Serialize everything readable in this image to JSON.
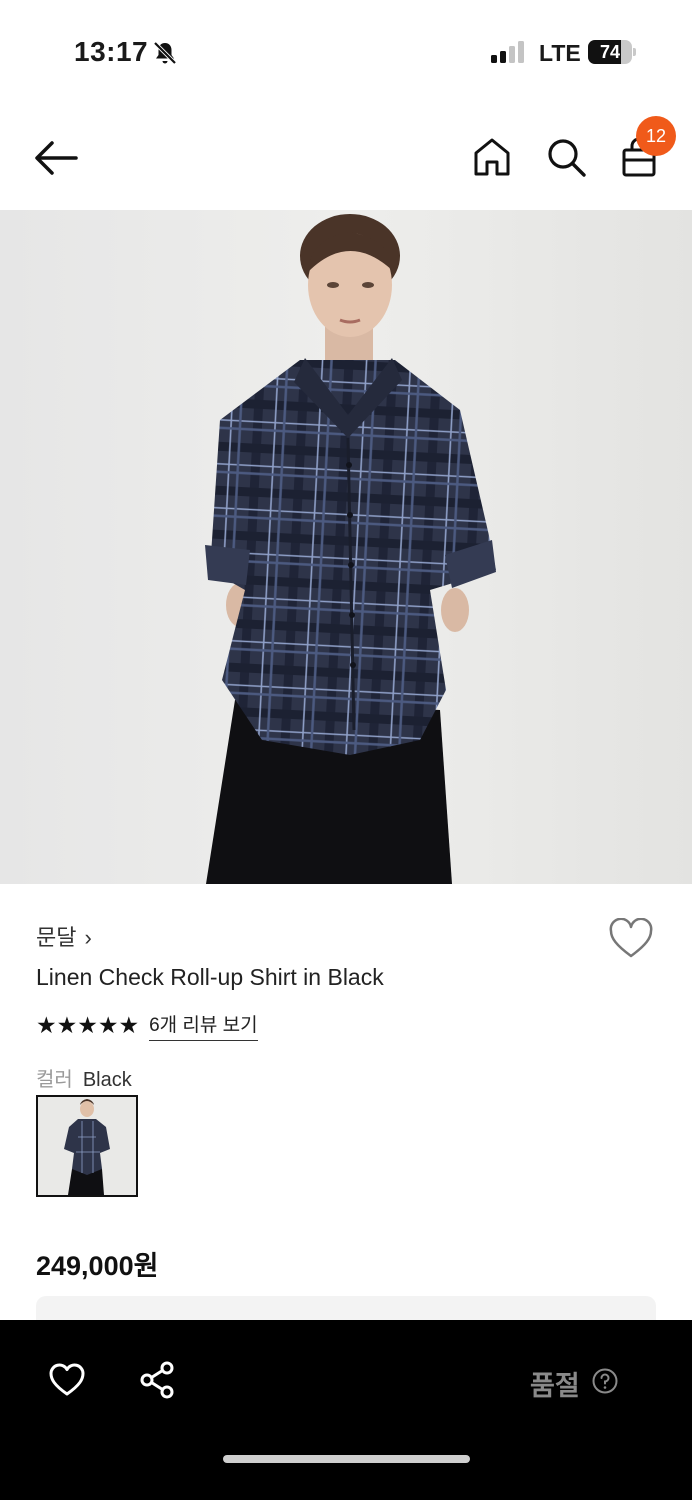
{
  "status_bar": {
    "time": "13:17",
    "network": "LTE",
    "battery_level": "74",
    "battery_fraction": 0.74
  },
  "nav": {
    "cart_count": "12",
    "icons": [
      "back-arrow-icon",
      "home-icon",
      "search-icon",
      "shopping-bag-icon"
    ]
  },
  "product": {
    "brand": "문달",
    "brand_chevron": "›",
    "title": "Linen Check Roll-up Shirt in Black",
    "stars": "★★★★★",
    "rating": 5,
    "review_link": "6개 리뷰 보기",
    "color_label": "컬러",
    "color_value": "Black",
    "price": "249,000원"
  },
  "bottom_bar": {
    "sold_out_label": "품절",
    "icons": [
      "heart-outline-icon",
      "share-icon",
      "question-circle-icon"
    ]
  },
  "colors": {
    "badge": "#f05a1a",
    "bottom_bar_bg": "#000000",
    "sold_out_text": "#8a8a8a"
  }
}
